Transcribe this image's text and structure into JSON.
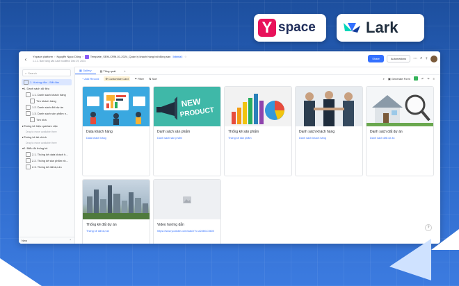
{
  "brand": {
    "yspace_mark": "Y",
    "yspace_text": "space",
    "lark_text": "Lark"
  },
  "topbar": {
    "breadcrumb": [
      "Ynpace platform",
      "Nguyễn Ngọc Dũng"
    ],
    "title": "Template_SEM-CRM-01-2024_Quản lý khách hàng bất động sản",
    "tag": "Internal",
    "sub_left": "1.1.1. Bạn hàng sản",
    "sub_right": "Last modified: Dec 19, 2024",
    "share_label": "Share",
    "automations_label": "Automations"
  },
  "sidebar": {
    "search_placeholder": "Search",
    "items": [
      {
        "label": "1. Hướng dẫn - Bắt đầu",
        "active": true
      },
      {
        "label": "1. Danh sách dữ liệu"
      },
      {
        "label": "1.1. Danh sách khách hàng"
      },
      {
        "label": "Tìm khách hàng"
      },
      {
        "label": "1.2. Danh sách đất dự án"
      },
      {
        "label": "1.3. Danh sách sản phẩm n..."
      },
      {
        "label": "Tìm nhà"
      },
      {
        "label": "Thống kê hiệu quả làm việc"
      },
      {
        "label": "Drag to move available there"
      },
      {
        "label": "Thống kê tài chính"
      },
      {
        "label": "Drag to move available there"
      },
      {
        "label": "2. Biểu đồ thống kê"
      },
      {
        "label": "2.1. Thống kê data khách h..."
      },
      {
        "label": "2.2. Thống kê sản phẩm nh..."
      },
      {
        "label": "2.3. Thống kê đất dự án"
      }
    ],
    "new_label": "New"
  },
  "views": {
    "tabs": [
      "Gallery",
      "Tổng quát"
    ],
    "add": "+"
  },
  "toolbar": {
    "add_record": "+ Add Record",
    "customize": "Customize Card",
    "filter": "Filter",
    "sort": "Sort",
    "generate": "Generate Form"
  },
  "cards": [
    {
      "title": "Data khách hàng",
      "link": "Data khách hàng"
    },
    {
      "title": "Danh sách sản phẩm",
      "link": "Danh sách sản phẩm"
    },
    {
      "title": "Thống kê sản phẩm",
      "link": "Thống kê sản phẩm"
    },
    {
      "title": "Danh sách khách hàng",
      "link": "Danh sách khách hàng"
    },
    {
      "title": "Danh sách đất dự án",
      "link": "Danh sách đất dự án"
    },
    {
      "title": "Thống kê đất dự án",
      "link": "Thống kê đất dự án"
    },
    {
      "title": "Video hướng dẫn",
      "link": "https://www.youtube.com/watch?v=a2dbt1C5k0lI"
    }
  ],
  "new_product_text": "NEW PRODUCT",
  "help": "?"
}
